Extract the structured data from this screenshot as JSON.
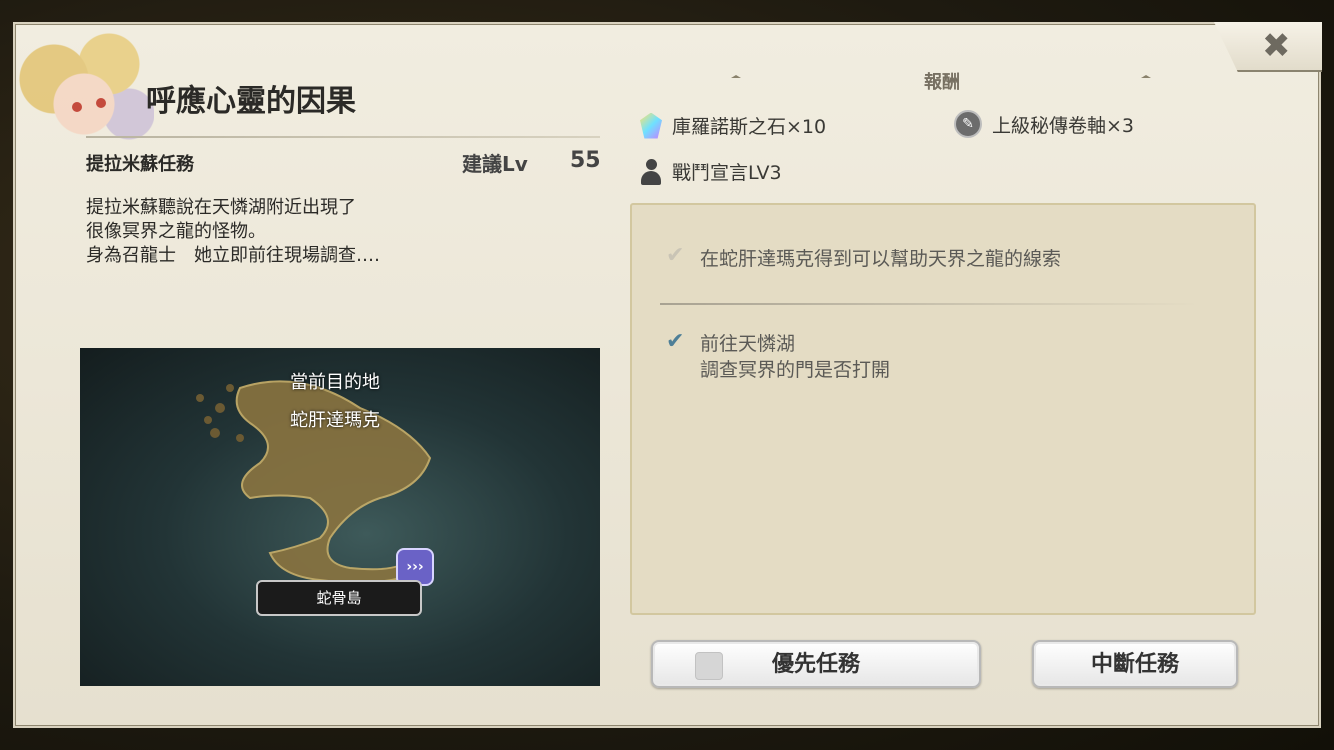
{
  "quest": {
    "title": "呼應心靈的因果",
    "type": "提拉米蘇任務",
    "recommended_label": "建議Lv",
    "recommended_value": "55",
    "description": [
      "提拉米蘇聽說在天憐湖附近出現了",
      "很像冥界之龍的怪物。",
      "身為召龍士　她立即前往現場調查‥‥"
    ]
  },
  "map": {
    "current_label": "當前目的地",
    "destination": "蛇肝達瑪克",
    "location_plate": "蛇骨島",
    "pin_icon": "destination-marker-icon",
    "pin_glyph": "›››"
  },
  "rewards": {
    "header": "報酬",
    "items": [
      {
        "icon": "crystal-icon",
        "label": "庫羅諾斯之石×10"
      },
      {
        "icon": "scroll-icon",
        "label": "上級秘傳卷軸×3"
      },
      {
        "icon": "person-icon",
        "label": "戰鬥宣言LV3"
      }
    ]
  },
  "objectives": [
    {
      "text": "在蛇肝達瑪克得到可以幫助天界之龍的線索",
      "done": true,
      "check_color": "#c9c4b5"
    },
    {
      "text": "前往天憐湖",
      "subtext": "調查冥界的門是否打開",
      "done": false,
      "check_color": "#4e7f97"
    }
  ],
  "buttons": {
    "priority": "優先任務",
    "abort": "中斷任務",
    "close_glyph": "✖"
  },
  "colors": {
    "panel": "#ece7d8",
    "objective_box": "#e4dcc4",
    "pin": "#6a62c6"
  }
}
